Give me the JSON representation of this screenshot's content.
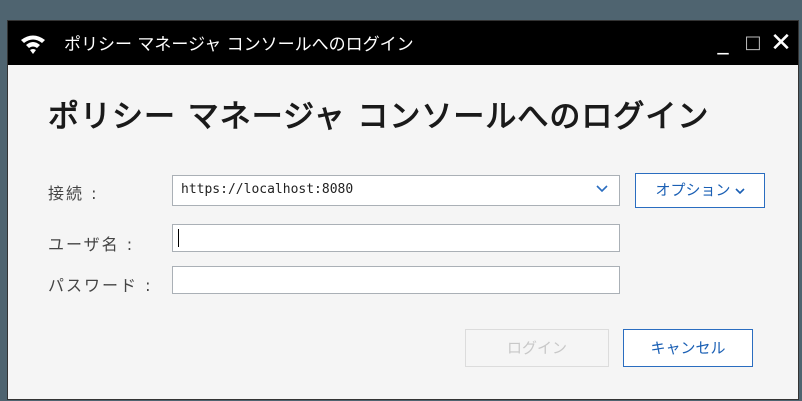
{
  "window": {
    "title": "ポリシー マネージャ コンソールへのログイン",
    "icon": "firebox-wifi-icon",
    "controls": {
      "minimize": "_",
      "maximize": "□",
      "close": "✕"
    }
  },
  "heading": "ポリシー マネージャ コンソールへのログイン",
  "form": {
    "connection_label": "接続 :",
    "connection_value": "https://localhost:8080",
    "username_label": "ユーザ名 :",
    "username_value": "",
    "password_label": "パスワード :",
    "password_value": ""
  },
  "buttons": {
    "options": "オプション",
    "login": "ログイン",
    "cancel": "キャンセル"
  },
  "colors": {
    "titlebar": "#000000",
    "accent": "#1a5fb4",
    "disabled_text": "#c8c8c8"
  }
}
